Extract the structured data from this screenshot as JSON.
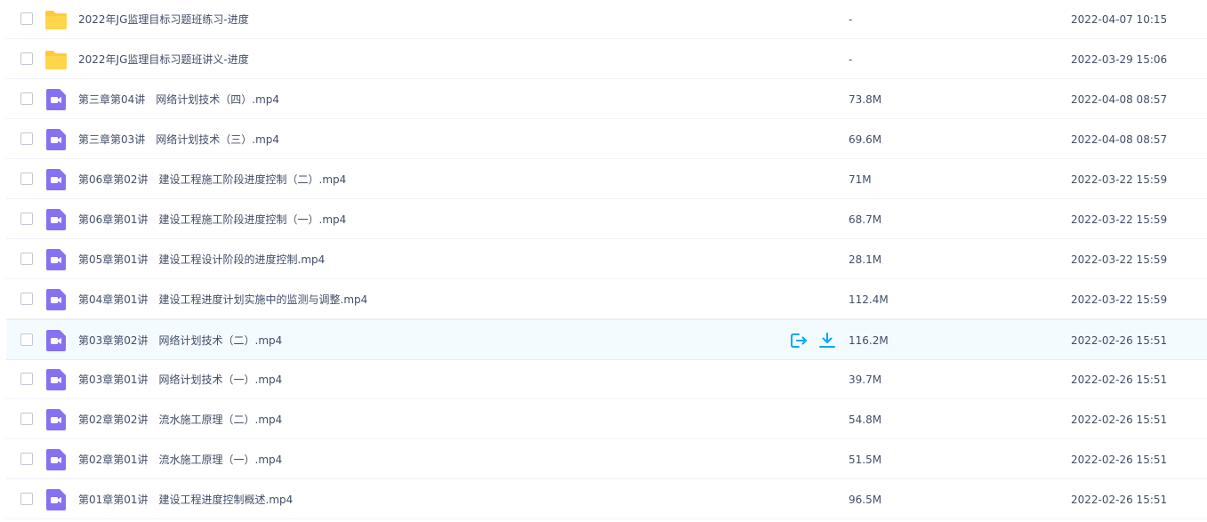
{
  "colors": {
    "folder": "#FFC93C",
    "video": "#8672F1",
    "action": "#06A7FF",
    "text": "#424E67",
    "hover_row": "#F4FBFF"
  },
  "files": [
    {
      "name": "2022年JG监理目标习题班练习-进度",
      "type": "folder",
      "icon": "folder-icon",
      "size": "-",
      "date": "2022-04-07 10:15"
    },
    {
      "name": "2022年JG监理目标习题班讲义-进度",
      "type": "folder",
      "icon": "folder-icon",
      "size": "-",
      "date": "2022-03-29 15:06"
    },
    {
      "name": "第三章第04讲　网络计划技术（四）.mp4",
      "type": "video",
      "icon": "video-file-icon",
      "size": "73.8M",
      "date": "2022-04-08 08:57"
    },
    {
      "name": "第三章第03讲　网络计划技术（三）.mp4",
      "type": "video",
      "icon": "video-file-icon",
      "size": "69.6M",
      "date": "2022-04-08 08:57"
    },
    {
      "name": "第06章第02讲　建设工程施工阶段进度控制（二）.mp4",
      "type": "video",
      "icon": "video-file-icon",
      "size": "71M",
      "date": "2022-03-22 15:59"
    },
    {
      "name": "第06章第01讲　建设工程施工阶段进度控制（一）.mp4",
      "type": "video",
      "icon": "video-file-icon",
      "size": "68.7M",
      "date": "2022-03-22 15:59"
    },
    {
      "name": "第05章第01讲　建设工程设计阶段的进度控制.mp4",
      "type": "video",
      "icon": "video-file-icon",
      "size": "28.1M",
      "date": "2022-03-22 15:59"
    },
    {
      "name": "第04章第01讲　建设工程进度计划实施中的监测与调整.mp4",
      "type": "video",
      "icon": "video-file-icon",
      "size": "112.4M",
      "date": "2022-03-22 15:59"
    },
    {
      "name": "第03章第02讲　网络计划技术（二）.mp4",
      "type": "video",
      "icon": "video-file-icon",
      "size": "116.2M",
      "date": "2022-02-26 15:51",
      "hovered": true
    },
    {
      "name": "第03章第01讲　网络计划技术（一）.mp4",
      "type": "video",
      "icon": "video-file-icon",
      "size": "39.7M",
      "date": "2022-02-26 15:51"
    },
    {
      "name": "第02章第02讲　流水施工原理（二）.mp4",
      "type": "video",
      "icon": "video-file-icon",
      "size": "54.8M",
      "date": "2022-02-26 15:51"
    },
    {
      "name": "第02章第01讲　流水施工原理（一）.mp4",
      "type": "video",
      "icon": "video-file-icon",
      "size": "51.5M",
      "date": "2022-02-26 15:51"
    },
    {
      "name": "第01章第01讲　建设工程进度控制概述.mp4",
      "type": "video",
      "icon": "video-file-icon",
      "size": "96.5M",
      "date": "2022-02-26 15:51"
    }
  ],
  "row_actions": [
    {
      "icon": "share-icon"
    },
    {
      "icon": "download-icon"
    }
  ]
}
